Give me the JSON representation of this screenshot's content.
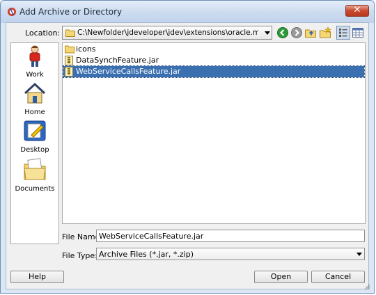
{
  "window": {
    "title": "Add Archive or Directory"
  },
  "location": {
    "label": "Location:",
    "path": "C:\\Newfolder\\jdeveloper\\jdev\\extensions\\oracle.maf\\FARs..."
  },
  "toolbar": {
    "buttons": [
      "back-icon",
      "forward-icon",
      "up-folder-icon",
      "new-folder-icon",
      "list-view-icon",
      "details-view-icon"
    ]
  },
  "places": [
    {
      "label": "Work",
      "icon": "user-icon"
    },
    {
      "label": "Home",
      "icon": "home-icon"
    },
    {
      "label": "Desktop",
      "icon": "desktop-icon"
    },
    {
      "label": "Documents",
      "icon": "documents-icon"
    }
  ],
  "files": [
    {
      "name": "icons",
      "type": "folder",
      "selected": false
    },
    {
      "name": "DataSynchFeature.jar",
      "type": "jar",
      "selected": false
    },
    {
      "name": "WebServiceCallsFeature.jar",
      "type": "jar",
      "selected": true
    }
  ],
  "file_name": {
    "label": "File Name:",
    "value": "WebServiceCallsFeature.jar"
  },
  "file_type": {
    "label": "File Type:",
    "value": "Archive Files (*.jar, *.zip)"
  },
  "buttons": {
    "help": "Help",
    "open": "Open",
    "cancel": "Cancel"
  },
  "colors": {
    "selection": "#3a6fb0",
    "close": "#c8492e"
  }
}
